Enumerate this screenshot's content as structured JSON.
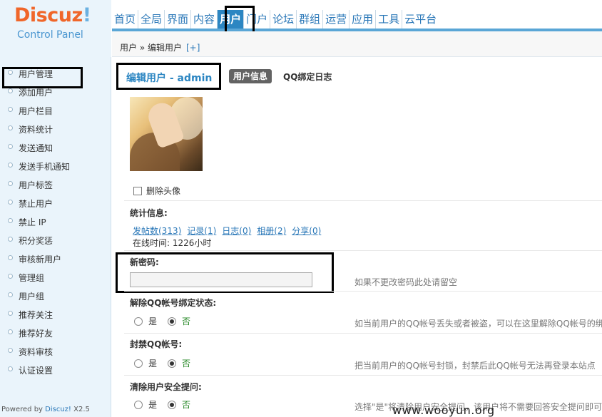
{
  "logo": {
    "brand": "Discuz",
    "bang": "!",
    "subtitle": "Control Panel"
  },
  "topnav": {
    "items": [
      "首页",
      "全局",
      "界面",
      "内容",
      "用户",
      "门户",
      "论坛",
      "群组",
      "运营",
      "应用",
      "工具",
      "云平台"
    ],
    "active_index": 4
  },
  "breadcrumb": {
    "path": "用户 » 编辑用户",
    "plus": "[+]"
  },
  "sidebar": {
    "items": [
      "用户管理",
      "添加用户",
      "用户栏目",
      "资料统计",
      "发送通知",
      "发送手机通知",
      "用户标签",
      "禁止用户",
      "禁止 IP",
      "积分奖惩",
      "审核新用户",
      "管理组",
      "用户组",
      "推荐关注",
      "推荐好友",
      "资料审核",
      "认证设置"
    ],
    "active_index": 0,
    "powered_prefix": "Powered by ",
    "powered_brand": "Discuz!",
    "powered_version": " X2.5"
  },
  "main": {
    "title": "编辑用户 - admin",
    "tab_info": "用户信息",
    "tab_qq": "QQ绑定日志",
    "delete_avatar": "删除头像",
    "stats": {
      "title": "统计信息:",
      "links": [
        "发帖数(313)",
        "记录(1)",
        "日志(0)",
        "相册(2)",
        "分享(0)"
      ],
      "online": "在线时间: 1226小时"
    },
    "password": {
      "title": "新密码:",
      "value": "",
      "tip": "如果不更改密码此处请留空"
    },
    "unbind": {
      "title": "解除QQ帐号绑定状态:",
      "yes": "是",
      "no": "否",
      "tip": "如当前用户的QQ帐号丢失或者被盗，可以在这里解除QQ帐号的绑"
    },
    "ban": {
      "title": "封禁QQ帐号:",
      "yes": "是",
      "no": "否",
      "tip": "把当前用户的QQ帐号封锁，封禁后此QQ帐号无法再登录本站点"
    },
    "clear": {
      "title": "清除用户安全提问:",
      "yes": "是",
      "no": "否",
      "tip": "选择\"是\"将清除用户安全提问，该用户将不需要回答安全提问即可"
    }
  },
  "watermark": "www.wooyun.org",
  "colors": {
    "brand_orange": "#f0662a",
    "nav_blue": "#2c86c2",
    "link_blue": "#2b78b8",
    "sidebar_bg": "#eaf4fb",
    "highlight_box": "#000000"
  }
}
